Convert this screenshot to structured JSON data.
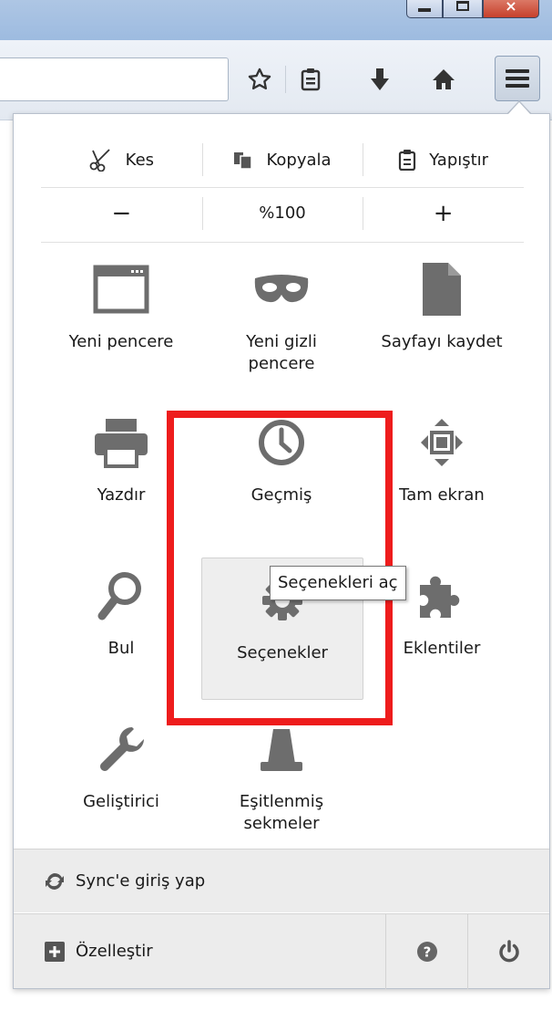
{
  "edit_controls": {
    "cut_label": "Kes",
    "copy_label": "Kopyala",
    "paste_label": "Yapıştır"
  },
  "zoom_controls": {
    "zoom_out": "−",
    "zoom_level": "%100",
    "zoom_in": "+"
  },
  "menu_items": {
    "new_window": "Yeni pencere",
    "new_private_window_line1": "Yeni gizli",
    "new_private_window_line2": "pencere",
    "save_page": "Sayfayı kaydet",
    "print": "Yazdır",
    "history": "Geçmiş",
    "fullscreen": "Tam ekran",
    "find": "Bul",
    "options": "Seçenekler",
    "addons": "Eklentiler",
    "developer": "Geliştirici",
    "synced_tabs_line1": "Eşitlenmiş",
    "synced_tabs_line2": "sekmeler"
  },
  "tooltip": {
    "text": "Seçenekleri aç"
  },
  "footer": {
    "sync_label": "Sync'e giriş yap",
    "customize_label": "Özelleştir"
  },
  "icons": {
    "toolbar": [
      "star-icon",
      "reading-list-icon",
      "download-icon",
      "home-icon",
      "hamburger-menu-icon"
    ],
    "footer": [
      "help-icon",
      "power-icon"
    ]
  },
  "colors": {
    "highlight_box": "#ee1c1c",
    "icon_gray": "#6d6d6d",
    "footer_bg": "#ececec"
  }
}
